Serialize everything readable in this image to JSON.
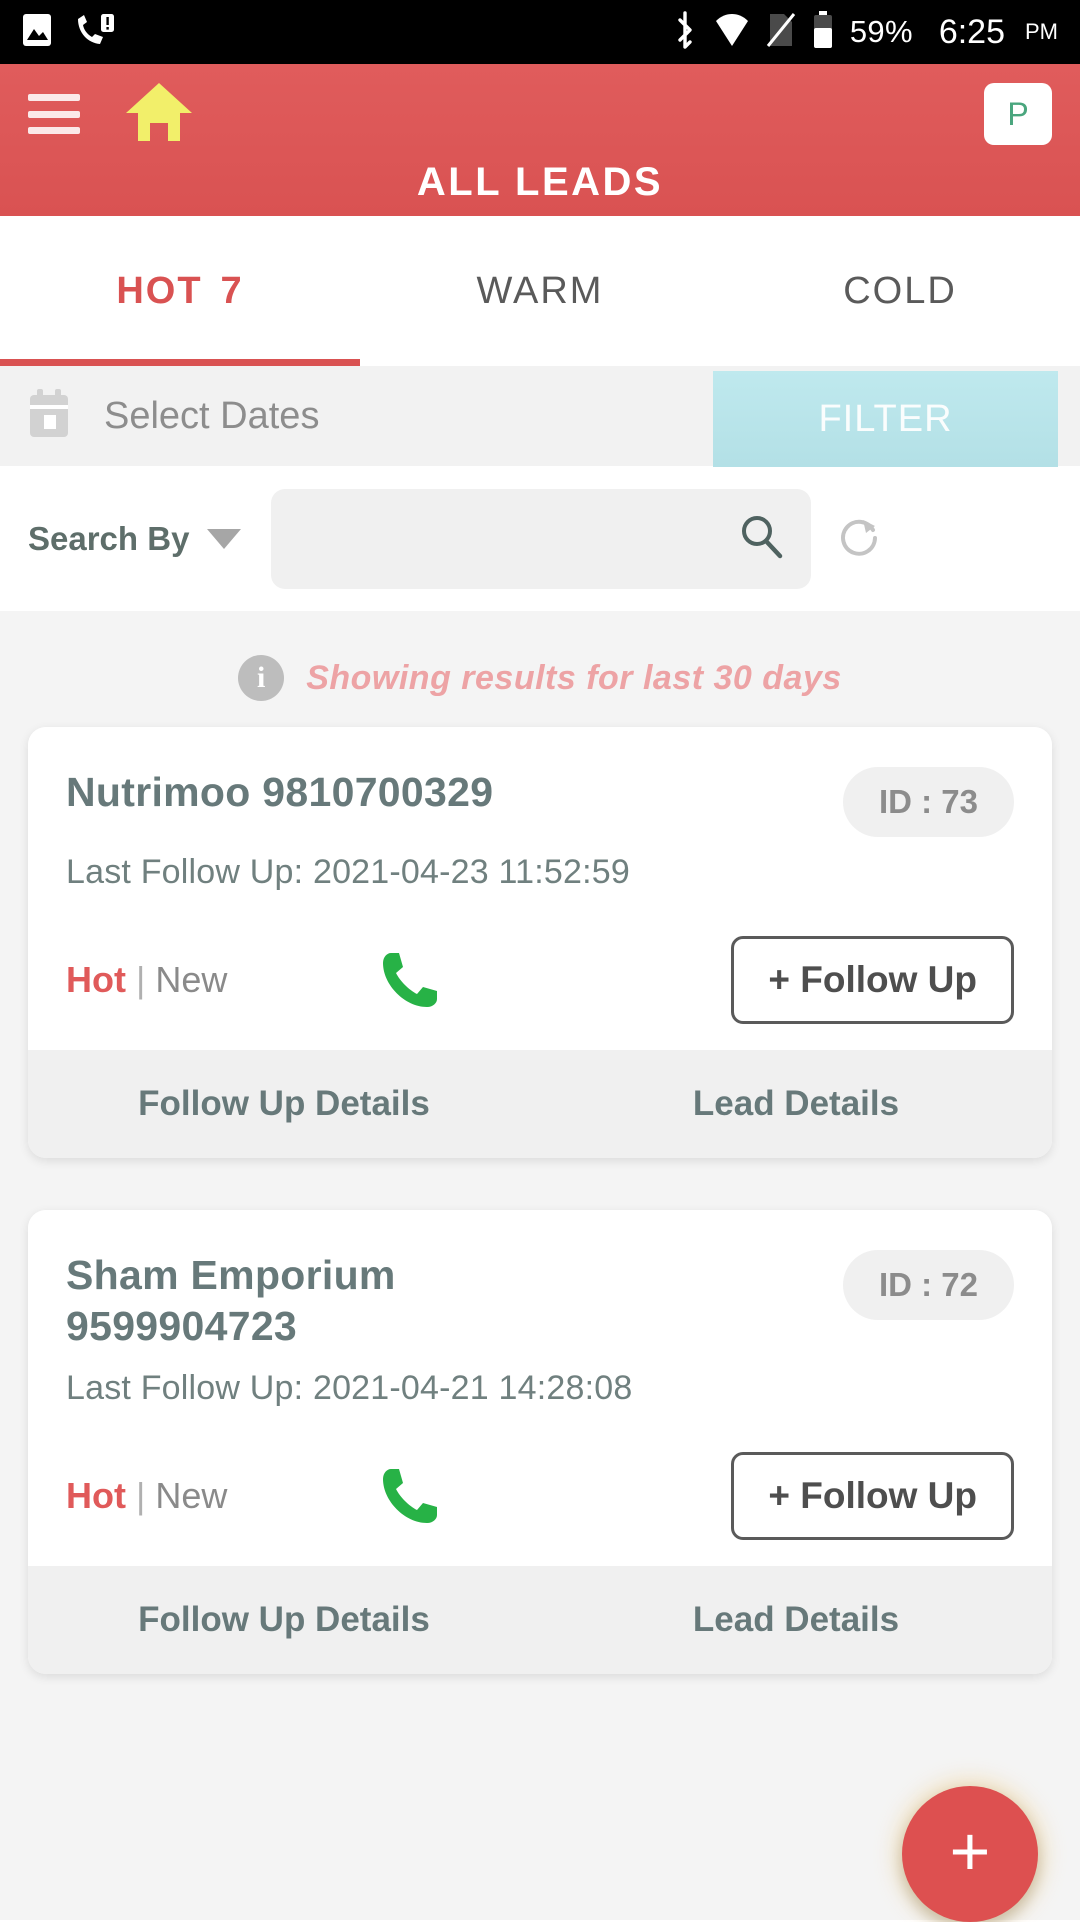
{
  "status_bar": {
    "battery_percent": "59%",
    "time": "6:25",
    "am_pm": "PM",
    "icons": [
      "image-icon",
      "missed-call-icon",
      "bluetooth-icon",
      "wifi-icon",
      "sim-off-icon",
      "battery-icon"
    ]
  },
  "app_bar": {
    "menu_icon": "hamburger-menu-icon",
    "home_icon": "home-icon",
    "profile_initial": "P",
    "title": "ALL LEADS",
    "color": "#d95252"
  },
  "tabs": [
    {
      "label": "HOT",
      "count": "7",
      "active": true
    },
    {
      "label": "WARM",
      "count": "",
      "active": false
    },
    {
      "label": "COLD",
      "count": "",
      "active": false
    }
  ],
  "date_filter": {
    "calendar_icon": "calendar-icon",
    "placeholder": "Select Dates",
    "filter_label": "FILTER",
    "filter_color": "#b9e5ea"
  },
  "search": {
    "search_by_label": "Search By",
    "caret_icon": "chevron-down-icon",
    "value": "",
    "placeholder": "",
    "search_icon": "search-icon",
    "refresh_icon": "refresh-icon"
  },
  "banner": {
    "icon": "info-icon",
    "text": "Showing results for last 30 days",
    "color": "#eda3a5"
  },
  "leads": [
    {
      "name": "Nutrimoo 9810700329",
      "id_label": "ID : 73",
      "last_follow_up": "Last Follow Up: 2021-04-23 11:52:59",
      "temperature": "Hot",
      "separator": "|",
      "stage": "New",
      "call_icon": "phone-icon",
      "follow_up_button": "+ Follow Up",
      "footer": {
        "follow_up_details": "Follow Up Details",
        "lead_details": "Lead Details"
      }
    },
    {
      "name": "Sham Emporium 9599904723",
      "id_label": "ID : 72",
      "last_follow_up": "Last Follow Up: 2021-04-21 14:28:08",
      "temperature": "Hot",
      "separator": "|",
      "stage": "New",
      "call_icon": "phone-icon",
      "follow_up_button": "+ Follow Up",
      "footer": {
        "follow_up_details": "Follow Up Details",
        "lead_details": "Lead Details"
      }
    }
  ],
  "fab": {
    "icon": "plus-icon",
    "label": "+",
    "color": "#dd5050"
  }
}
